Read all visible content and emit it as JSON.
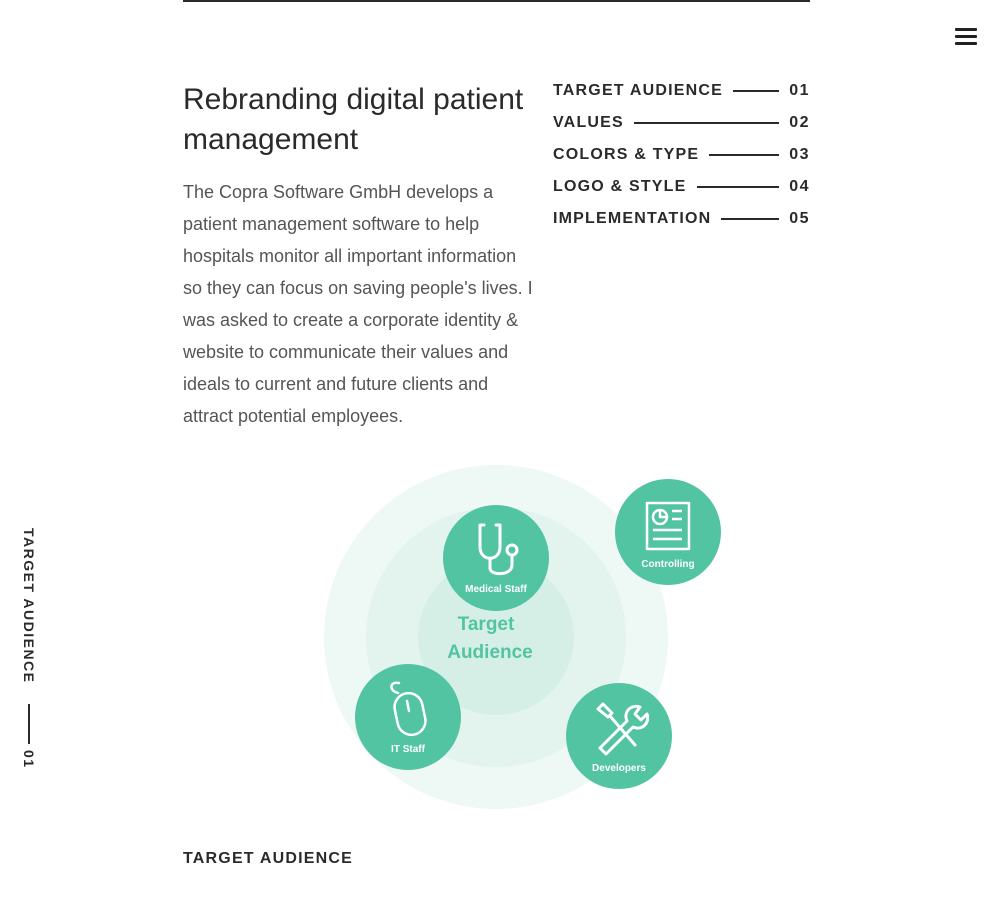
{
  "header": {
    "menu_icon": "hamburger-menu-icon"
  },
  "project": {
    "title": "Rebranding digital patient management",
    "intro": "The Copra Software GmbH develops a patient management software to help hospitals monitor all important information so they can focus on saving people's lives. I was asked to create a corporate identity & website to communicate their values and ideals to current and future clients and attract potential employees."
  },
  "toc": {
    "items": [
      {
        "label": "TARGET AUDIENCE",
        "number": "01"
      },
      {
        "label": "VALUES",
        "number": "02"
      },
      {
        "label": "COLORS & TYPE",
        "number": "03"
      },
      {
        "label": "LOGO & STYLE",
        "number": "04"
      },
      {
        "label": "IMPLEMENTATION",
        "number": "05"
      }
    ]
  },
  "side_indicator": {
    "label": "TARGET AUDIENCE",
    "number": "01"
  },
  "diagram": {
    "center_line1": "Target",
    "center_line2": "Audience",
    "nodes": [
      {
        "label": "Medical Staff",
        "icon": "stethoscope-icon"
      },
      {
        "label": "Controlling",
        "icon": "report-chart-icon"
      },
      {
        "label": "Developers",
        "icon": "tools-icon"
      },
      {
        "label": "IT Staff",
        "icon": "mouse-icon"
      }
    ],
    "colors": {
      "outer": "#eef8f5",
      "middle": "#e3f4ee",
      "inner": "#d6efe6",
      "node": "#52c4a2",
      "center_text": "#52c4a2"
    }
  },
  "section": {
    "heading": "TARGET AUDIENCE"
  }
}
